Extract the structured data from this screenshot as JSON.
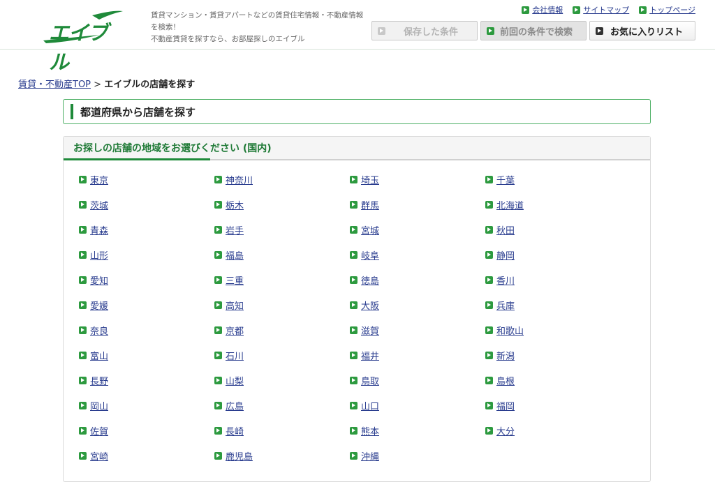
{
  "header": {
    "logo_text": "エイブル",
    "tagline": [
      "賃貸マンション・賃貸アパートなどの賃貸住宅情報・不動産情報",
      "を検索！",
      "不動産賃貸を探すなら、お部屋探しのエイブル"
    ],
    "toplinks": [
      "会社情報",
      "サイトマップ",
      "トップページ"
    ],
    "buttons": {
      "saved": "保存した条件",
      "previous": "前回の条件で検索",
      "favorites": "お気に入りリスト"
    }
  },
  "breadcrumb": {
    "home": "賃貸・不動産TOP",
    "separator": ">",
    "current": "エイブルの店舗を探す"
  },
  "section_title": "都道府県から店舗を探す",
  "panel_title": "お探しの店舗の地域をお選びください (国内)",
  "prefectures": [
    "東京",
    "神奈川",
    "埼玉",
    "千葉",
    "茨城",
    "栃木",
    "群馬",
    "北海道",
    "青森",
    "岩手",
    "宮城",
    "秋田",
    "山形",
    "福島",
    "岐阜",
    "静岡",
    "愛知",
    "三重",
    "徳島",
    "香川",
    "愛媛",
    "高知",
    "大阪",
    "兵庫",
    "奈良",
    "京都",
    "滋賀",
    "和歌山",
    "富山",
    "石川",
    "福井",
    "新潟",
    "長野",
    "山梨",
    "鳥取",
    "島根",
    "岡山",
    "広島",
    "山口",
    "福岡",
    "佐賀",
    "長崎",
    "熊本",
    "大分",
    "宮崎",
    "鹿児島",
    "沖縄"
  ],
  "colors": {
    "accent": "#1f8a3a",
    "link": "#2a3d8f"
  }
}
